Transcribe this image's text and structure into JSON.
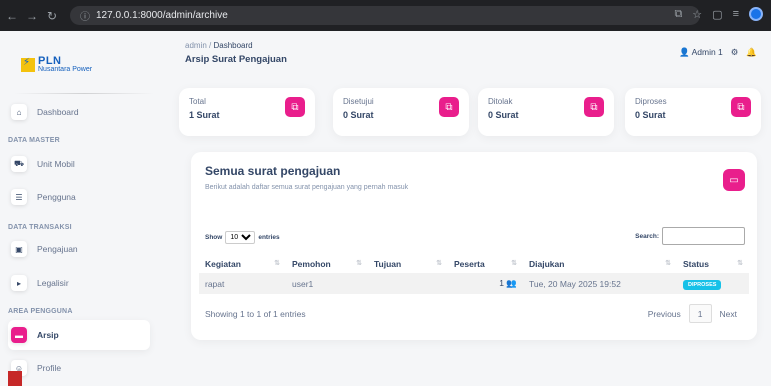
{
  "browser": {
    "url": "127.0.0.1:8000/admin/archive"
  },
  "logo": {
    "brand": "PLN",
    "sub": "Nusantara Power"
  },
  "sidebar": {
    "items": [
      {
        "label": "Dashboard",
        "icon": "home-icon"
      },
      {
        "label": "Unit Mobil",
        "icon": "car-icon"
      },
      {
        "label": "Pengguna",
        "icon": "users-icon"
      },
      {
        "label": "Pengajuan",
        "icon": "document-icon"
      },
      {
        "label": "Legalisir",
        "icon": "stamp-icon"
      },
      {
        "label": "Arsip",
        "icon": "archive-icon"
      },
      {
        "label": "Profile",
        "icon": "profile-icon"
      }
    ],
    "sections": [
      "DATA MASTER",
      "DATA TRANSAKSI",
      "AREA PENGGUNA"
    ]
  },
  "header": {
    "breadcrumb_root": "admin",
    "breadcrumb_current": "Dashboard",
    "title": "Arsip Surat Pengajuan",
    "user": "Admin 1"
  },
  "stats": [
    {
      "title": "Total",
      "value": "1 Surat"
    },
    {
      "title": "Disetujui",
      "value": "0 Surat"
    },
    {
      "title": "Ditolak",
      "value": "0 Surat"
    },
    {
      "title": "Diproses",
      "value": "0 Surat"
    }
  ],
  "main": {
    "heading": "Semua surat pengajuan",
    "description": "Berikut adalah daftar semua surat pengajuan yang pernah masuk",
    "show_label": "Show",
    "entries_label": "entries",
    "entries_value": "10",
    "search_label": "Search:",
    "columns": [
      "Kegiatan",
      "Pemohon",
      "Tujuan",
      "Peserta",
      "Diajukan",
      "Status"
    ],
    "rows": [
      {
        "kegiatan": "rapat",
        "pemohon": "user1",
        "tujuan": "",
        "peserta": "1",
        "diajukan": "Tue, 20 May 2025 19:52",
        "status": "DIPROSES"
      }
    ],
    "info": "Showing 1 to 1 of 1 entries",
    "pager": {
      "prev": "Previous",
      "page": "1",
      "next": "Next"
    }
  },
  "colors": {
    "accent": "#e91e8c",
    "status_badge": "#17c1e8"
  }
}
